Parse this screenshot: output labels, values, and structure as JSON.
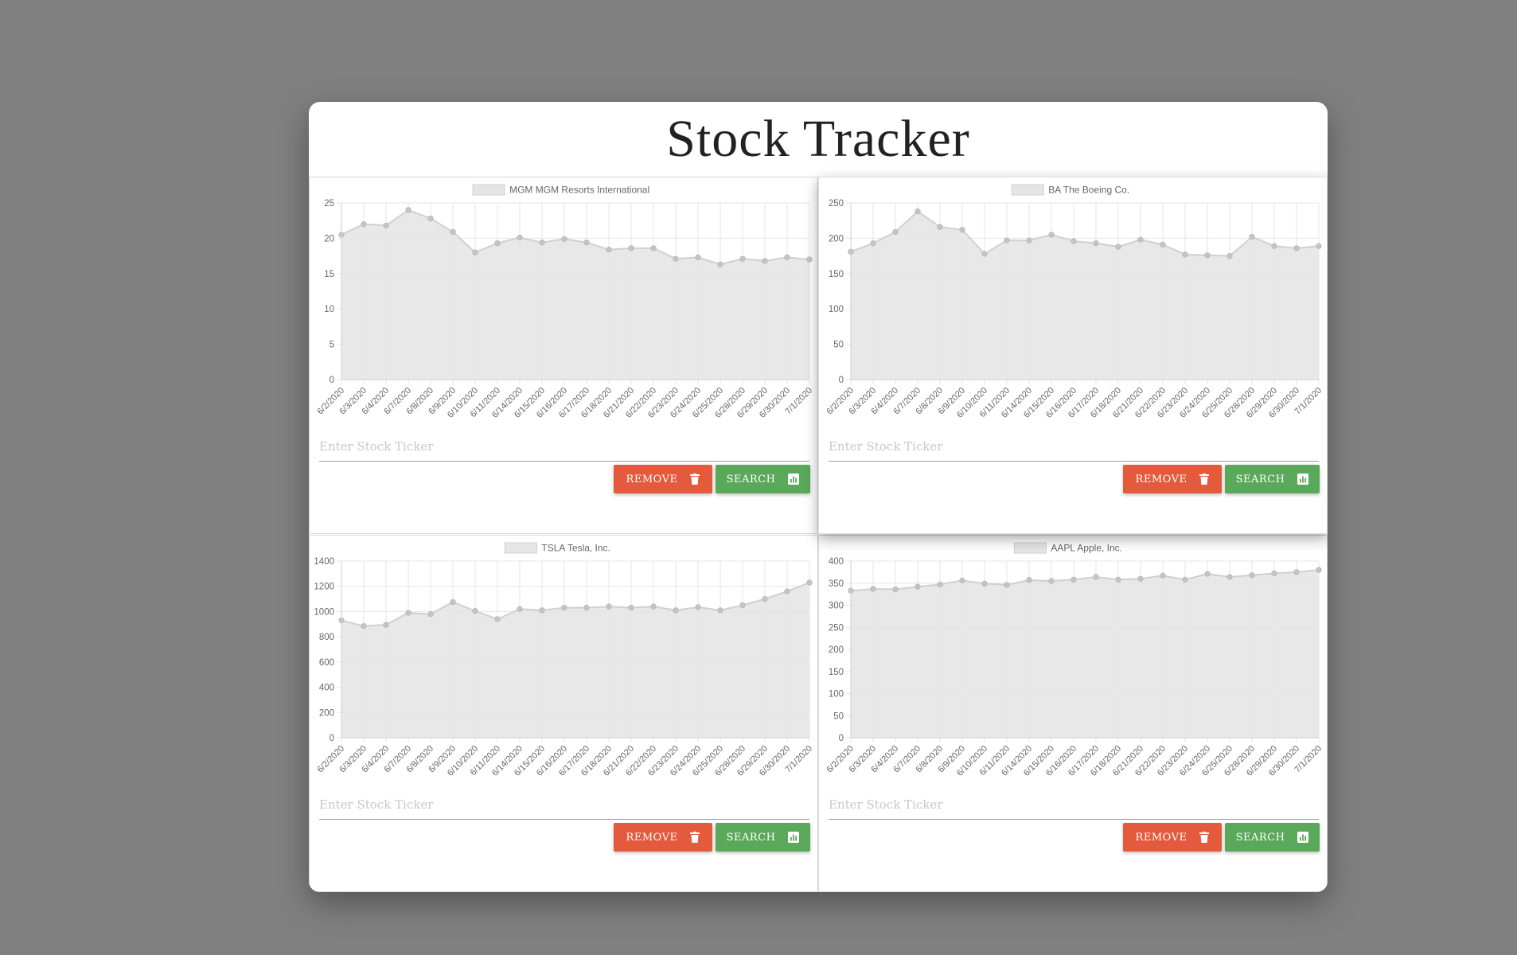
{
  "app": {
    "title": "Stock Tracker"
  },
  "panels": [
    {
      "legend": "MGM MGM Resorts International",
      "input_placeholder": "Enter Stock Ticker",
      "remove_label": "REMOVE",
      "search_label": "SEARCH"
    },
    {
      "legend": "BA The Boeing Co.",
      "input_placeholder": "Enter Stock Ticker",
      "remove_label": "REMOVE",
      "search_label": "SEARCH"
    },
    {
      "legend": "TSLA Tesla, Inc.",
      "input_placeholder": "Enter Stock Ticker",
      "remove_label": "REMOVE",
      "search_label": "SEARCH"
    },
    {
      "legend": "AAPL Apple, Inc.",
      "input_placeholder": "Enter Stock Ticker",
      "remove_label": "REMOVE",
      "search_label": "SEARCH"
    }
  ],
  "colors": {
    "remove": "#e45a3c",
    "search": "#5aa95a",
    "fill": "#e5e5e5",
    "line": "#d0d0d0",
    "point": "#c4c4c4",
    "grid": "#e6e6e6"
  },
  "icons": {
    "remove": "trash-icon",
    "search": "bar-chart-icon"
  },
  "chart_data": [
    {
      "type": "area",
      "title": "",
      "series": [
        {
          "name": "MGM MGM Resorts International",
          "values": [
            20.5,
            22.0,
            21.8,
            24.0,
            22.8,
            20.9,
            18.0,
            19.3,
            20.1,
            19.4,
            19.9,
            19.4,
            18.4,
            18.6,
            18.6,
            17.1,
            17.3,
            16.3,
            17.1,
            16.8,
            17.3,
            17.0
          ]
        }
      ],
      "categories": [
        "6/2/2020",
        "6/3/2020",
        "6/4/2020",
        "6/7/2020",
        "6/8/2020",
        "6/9/2020",
        "6/10/2020",
        "6/11/2020",
        "6/14/2020",
        "6/15/2020",
        "6/16/2020",
        "6/17/2020",
        "6/18/2020",
        "6/21/2020",
        "6/22/2020",
        "6/23/2020",
        "6/24/2020",
        "6/25/2020",
        "6/28/2020",
        "6/29/2020",
        "6/30/2020",
        "7/1/2020"
      ],
      "ylim": [
        0,
        25
      ],
      "yticks": [
        0,
        5,
        10,
        15,
        20,
        25
      ],
      "grid": true,
      "legend_position": "top"
    },
    {
      "type": "area",
      "title": "",
      "series": [
        {
          "name": "BA The Boeing Co.",
          "values": [
            181,
            193,
            209,
            238,
            216,
            212,
            178,
            197,
            197,
            205,
            196,
            193,
            188,
            198,
            191,
            177,
            176,
            175,
            202,
            189,
            186,
            189
          ]
        }
      ],
      "categories": [
        "6/2/2020",
        "6/3/2020",
        "6/4/2020",
        "6/7/2020",
        "6/8/2020",
        "6/9/2020",
        "6/10/2020",
        "6/11/2020",
        "6/14/2020",
        "6/15/2020",
        "6/16/2020",
        "6/17/2020",
        "6/18/2020",
        "6/21/2020",
        "6/22/2020",
        "6/23/2020",
        "6/24/2020",
        "6/25/2020",
        "6/28/2020",
        "6/29/2020",
        "6/30/2020",
        "7/1/2020"
      ],
      "ylim": [
        0,
        250
      ],
      "yticks": [
        0,
        50,
        100,
        150,
        200,
        250
      ],
      "grid": true,
      "legend_position": "top"
    },
    {
      "type": "area",
      "title": "",
      "series": [
        {
          "name": "TSLA Tesla, Inc.",
          "values": [
            930,
            885,
            895,
            990,
            980,
            1075,
            1005,
            940,
            1020,
            1010,
            1030,
            1030,
            1040,
            1030,
            1040,
            1010,
            1035,
            1010,
            1050,
            1100,
            1160,
            1230
          ]
        }
      ],
      "categories": [
        "6/2/2020",
        "6/3/2020",
        "6/4/2020",
        "6/7/2020",
        "6/8/2020",
        "6/9/2020",
        "6/10/2020",
        "6/11/2020",
        "6/14/2020",
        "6/15/2020",
        "6/16/2020",
        "6/17/2020",
        "6/18/2020",
        "6/21/2020",
        "6/22/2020",
        "6/23/2020",
        "6/24/2020",
        "6/25/2020",
        "6/28/2020",
        "6/29/2020",
        "6/30/2020",
        "7/1/2020"
      ],
      "ylim": [
        0,
        1400
      ],
      "yticks": [
        0,
        200,
        400,
        600,
        800,
        1000,
        1200,
        1400
      ],
      "grid": true,
      "legend_position": "top"
    },
    {
      "type": "area",
      "title": "",
      "series": [
        {
          "name": "AAPL Apple, Inc.",
          "values": [
            333,
            337,
            336,
            342,
            347,
            356,
            349,
            346,
            357,
            355,
            358,
            364,
            358,
            360,
            367,
            358,
            371,
            364,
            368,
            372,
            375,
            380
          ]
        }
      ],
      "categories": [
        "6/2/2020",
        "6/3/2020",
        "6/4/2020",
        "6/7/2020",
        "6/8/2020",
        "6/9/2020",
        "6/10/2020",
        "6/11/2020",
        "6/14/2020",
        "6/15/2020",
        "6/16/2020",
        "6/17/2020",
        "6/18/2020",
        "6/21/2020",
        "6/22/2020",
        "6/23/2020",
        "6/24/2020",
        "6/25/2020",
        "6/28/2020",
        "6/29/2020",
        "6/30/2020",
        "7/1/2020"
      ],
      "ylim": [
        0,
        400
      ],
      "yticks": [
        0,
        50,
        100,
        150,
        200,
        250,
        300,
        350,
        400
      ],
      "grid": true,
      "legend_position": "top"
    }
  ]
}
